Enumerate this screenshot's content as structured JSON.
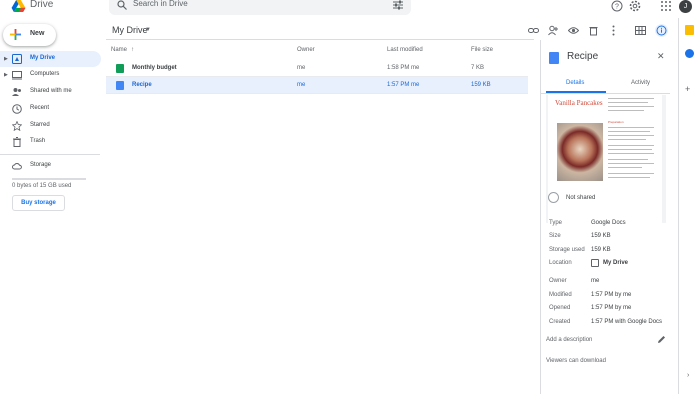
{
  "header": {
    "app_name": "Drive",
    "search_placeholder": "Search in Drive",
    "avatar_letter": "J"
  },
  "sidebar": {
    "new_label": "New",
    "items": [
      {
        "label": "My Drive",
        "icon": "my-drive-icon",
        "active": true,
        "expandable": true
      },
      {
        "label": "Computers",
        "icon": "computer-icon",
        "active": false,
        "expandable": true
      },
      {
        "label": "Shared with me",
        "icon": "people-icon",
        "active": false,
        "expandable": false
      },
      {
        "label": "Recent",
        "icon": "clock-icon",
        "active": false,
        "expandable": false
      },
      {
        "label": "Starred",
        "icon": "star-icon",
        "active": false,
        "expandable": false
      },
      {
        "label": "Trash",
        "icon": "trash-icon",
        "active": false,
        "expandable": false
      }
    ],
    "storage_label": "Storage",
    "storage_used_text": "0 bytes of 15 GB used",
    "storage_used_fraction": 0,
    "buy_storage_label": "Buy storage"
  },
  "main": {
    "title": "My Drive",
    "columns": [
      "Name",
      "Owner",
      "Last modified",
      "File size"
    ],
    "files": [
      {
        "name": "Monthly budget",
        "type": "sheets",
        "owner": "me",
        "modified": "1:58 PM  me",
        "size": "7 KB",
        "selected": false
      },
      {
        "name": "Recipe",
        "type": "docs",
        "owner": "me",
        "modified": "1:57 PM  me",
        "size": "159 KB",
        "selected": true
      }
    ]
  },
  "details": {
    "title": "Recipe",
    "tabs": [
      "Details",
      "Activity"
    ],
    "active_tab": "Details",
    "preview_title": "Vanilla Pancakes",
    "preview_heading": "Preparation",
    "sharing": "Not shared",
    "properties": [
      {
        "label": "Type",
        "value": "Google Docs"
      },
      {
        "label": "Size",
        "value": "159 KB"
      },
      {
        "label": "Storage used",
        "value": "159 KB"
      },
      {
        "label": "Location",
        "value": "My Drive"
      },
      {
        "label": "Owner",
        "value": "me"
      },
      {
        "label": "Modified",
        "value": "1:57 PM by me"
      },
      {
        "label": "Opened",
        "value": "1:57 PM by me"
      },
      {
        "label": "Created",
        "value": "1:57 PM with Google Docs"
      }
    ],
    "add_description": "Add a description",
    "viewers_text": "Viewers can download"
  },
  "colors": {
    "accent": "#1a73e8",
    "selection": "#e8f0fe",
    "sheets_green": "#0f9d58",
    "docs_blue": "#4285f4",
    "keep_yellow": "#fbbc04"
  }
}
